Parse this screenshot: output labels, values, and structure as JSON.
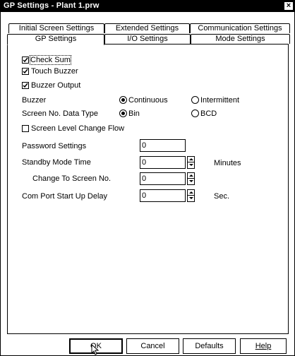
{
  "window": {
    "title": "GP Settings - Plant 1.prw"
  },
  "tabs": {
    "back_row": [
      "Initial Screen Settings",
      "Extended Settings",
      "Communication Settings"
    ],
    "front_row": [
      "GP Settings",
      "I/O Settings",
      "Mode Settings"
    ],
    "active": "GP Settings"
  },
  "gp": {
    "check_sum": {
      "label": "Check Sum",
      "checked": true
    },
    "touch_buzzer": {
      "label": "Touch Buzzer",
      "checked": true
    },
    "buzzer_output": {
      "label": "Buzzer Output",
      "checked": true
    },
    "buzzer": {
      "label": "Buzzer",
      "options": [
        "Continuous",
        "Intermittent"
      ],
      "selected": "Continuous"
    },
    "screen_no_type": {
      "label": "Screen No. Data Type",
      "options": [
        "Bin",
        "BCD"
      ],
      "selected": "Bin"
    },
    "screen_level_change": {
      "label": "Screen Level Change Flow",
      "checked": false
    },
    "password": {
      "label": "Password Settings",
      "value": "0"
    },
    "standby": {
      "label": "Standby Mode Time",
      "value": "0",
      "unit": "Minutes"
    },
    "change_screen": {
      "label": "Change To Screen No.",
      "value": "0"
    },
    "com_port": {
      "label": "Com Port Start Up Delay",
      "value": "0",
      "unit": "Sec."
    }
  },
  "buttons": {
    "ok": "OK",
    "cancel": "Cancel",
    "defaults": "Defaults",
    "help": "Help"
  }
}
